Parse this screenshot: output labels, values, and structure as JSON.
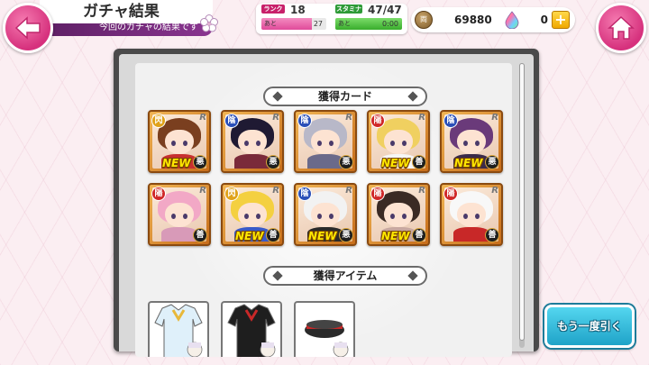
{
  "header": {
    "title": "ガチャ結果",
    "subtitle": "今回のガチャの結果です"
  },
  "status": {
    "rank_label": "ランク",
    "rank_value": "18",
    "rank_next_prefix": "あと",
    "rank_next_value": "27",
    "rank_progress": 0.78,
    "stamina_label": "スタミナ",
    "stamina_value": "47/47",
    "stamina_timer_prefix": "あと",
    "stamina_timer": "0:00",
    "stamina_progress": 1.0
  },
  "currency": {
    "coins": "69880",
    "gems": "0",
    "plus_label": "+"
  },
  "sections": {
    "cards_title": "獲得カード",
    "items_title": "獲得アイテム"
  },
  "cards": [
    {
      "attr": "閃",
      "attr_color": "#e0a21a",
      "rarity": "R",
      "align": "悪",
      "new": true,
      "new_label": "NEW",
      "hair": "#7a3f1f",
      "outfit": "#c83030"
    },
    {
      "attr": "陰",
      "attr_color": "#2a4fb8",
      "rarity": "R",
      "align": "悪",
      "new": false,
      "new_label": "",
      "hair": "#1f1a33",
      "outfit": "#7a2a3a"
    },
    {
      "attr": "陰",
      "attr_color": "#2a4fb8",
      "rarity": "R",
      "align": "悪",
      "new": false,
      "new_label": "",
      "hair": "#b8b8c8",
      "outfit": "#6a6a8a"
    },
    {
      "attr": "陽",
      "attr_color": "#d02828",
      "rarity": "R",
      "align": "善",
      "new": true,
      "new_label": "NEW",
      "hair": "#f0d060",
      "outfit": "#f6f6f6"
    },
    {
      "attr": "陰",
      "attr_color": "#2a4fb8",
      "rarity": "R",
      "align": "悪",
      "new": true,
      "new_label": "NEW",
      "hair": "#6a3a7a",
      "outfit": "#3a2a4a"
    },
    {
      "attr": "陽",
      "attr_color": "#d02828",
      "rarity": "R",
      "align": "善",
      "new": false,
      "new_label": "",
      "hair": "#f2a8c6",
      "outfit": "#d89ab8"
    },
    {
      "attr": "閃",
      "attr_color": "#e0a21a",
      "rarity": "R",
      "align": "善",
      "new": true,
      "new_label": "NEW",
      "hair": "#f4d040",
      "outfit": "#3a5ac8"
    },
    {
      "attr": "陰",
      "attr_color": "#2a4fb8",
      "rarity": "R",
      "align": "悪",
      "new": true,
      "new_label": "NEW",
      "hair": "#f2f2f2",
      "outfit": "#2a2a2a"
    },
    {
      "attr": "陽",
      "attr_color": "#d02828",
      "rarity": "R",
      "align": "善",
      "new": true,
      "new_label": "NEW",
      "hair": "#3a2a24",
      "outfit": "#c8a8a0"
    },
    {
      "attr": "陽",
      "attr_color": "#d02828",
      "rarity": "R",
      "align": "善",
      "new": false,
      "new_label": "",
      "hair": "#f8f8f8",
      "outfit": "#c82828"
    }
  ],
  "items": [
    {
      "name": "sailor-uniform",
      "color": "#dff0fa",
      "accent": "#e8b83a"
    },
    {
      "name": "black-jacket",
      "color": "#1e1e1e",
      "accent": "#c82828"
    },
    {
      "name": "hat",
      "color": "#2a2a2a",
      "accent": "#c82828"
    }
  ],
  "actions": {
    "draw_again": "もう一度引く"
  }
}
